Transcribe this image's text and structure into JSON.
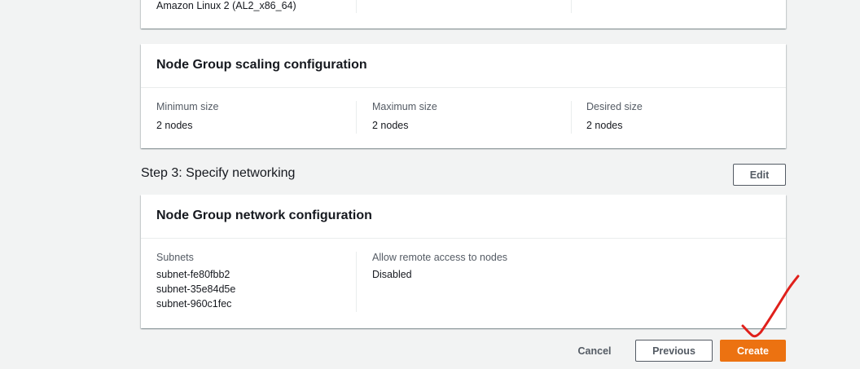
{
  "ami_card": {
    "ami_type_value": "Amazon Linux 2 (AL2_x86_64)"
  },
  "scaling_card": {
    "title": "Node Group scaling configuration",
    "minimum": {
      "label": "Minimum size",
      "value": "2 nodes"
    },
    "maximum": {
      "label": "Maximum size",
      "value": "2 nodes"
    },
    "desired": {
      "label": "Desired size",
      "value": "2 nodes"
    }
  },
  "step3": {
    "title": "Step 3: Specify networking",
    "edit_label": "Edit"
  },
  "network_card": {
    "title": "Node Group network configuration",
    "subnets_label": "Subnets",
    "subnets": [
      "subnet-fe80fbb2",
      "subnet-35e84d5e",
      "subnet-960c1fec"
    ],
    "remote_access_label": "Allow remote access to nodes",
    "remote_access_value": "Disabled"
  },
  "footer": {
    "cancel_label": "Cancel",
    "previous_label": "Previous",
    "create_label": "Create"
  },
  "colors": {
    "primary_button": "#ec7211",
    "annotation_mark": "#e0201b"
  },
  "icons": {
    "annotation": "red-checkmark-annotation-icon"
  }
}
